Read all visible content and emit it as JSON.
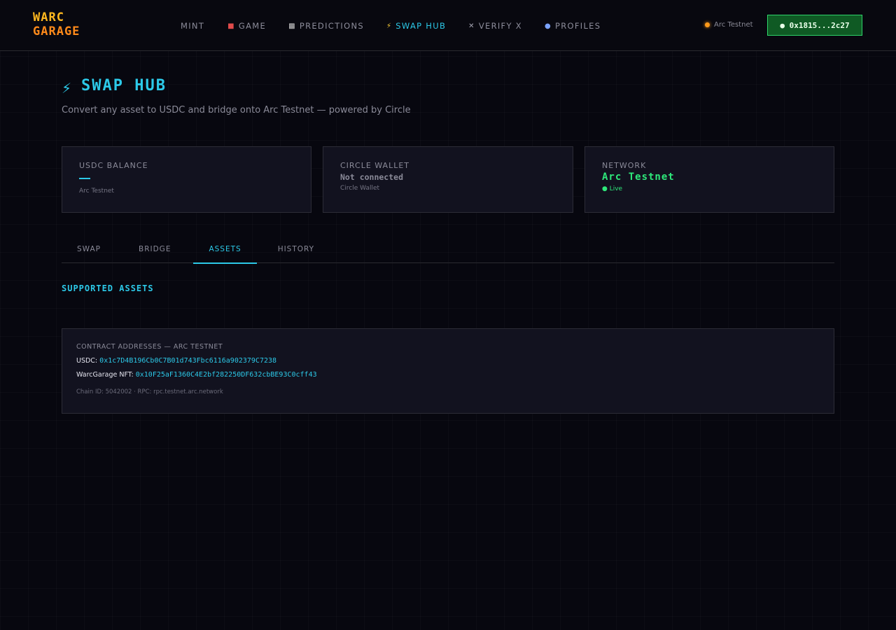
{
  "brand": {
    "line1": "WARC",
    "line2": "GARAGE"
  },
  "nav": [
    {
      "label": "MINT",
      "icon": ""
    },
    {
      "label": "GAME",
      "icon": "joystick-icon"
    },
    {
      "label": "PREDICTIONS",
      "icon": "checkered-flag-icon"
    },
    {
      "label": "SWAP HUB",
      "icon": "lightning-icon",
      "active": true
    },
    {
      "label": "VERIFY X",
      "icon": "x-icon"
    },
    {
      "label": "PROFILES",
      "icon": "person-icon"
    }
  ],
  "network_indicator": "Arc Testnet",
  "wallet_button": "● 0x1815...2c27",
  "page": {
    "title": "SWAP HUB",
    "subtitle": "Convert any asset to USDC and bridge onto Arc Testnet — powered by Circle"
  },
  "cards": {
    "balance": {
      "label": "USDC BALANCE",
      "sub": "Arc Testnet"
    },
    "wallet": {
      "label": "CIRCLE WALLET",
      "value": "Not connected",
      "sub": "Circle Wallet"
    },
    "network": {
      "label": "NETWORK",
      "value": "Arc Testnet",
      "status": "● Live"
    }
  },
  "tabs": [
    {
      "label": "SWAP"
    },
    {
      "label": "BRIDGE"
    },
    {
      "label": "ASSETS",
      "active": true
    },
    {
      "label": "HISTORY"
    }
  ],
  "section_title": "SUPPORTED ASSETS",
  "contracts": {
    "heading": "CONTRACT ADDRESSES — ARC TESTNET",
    "usdc_label": "USDC:",
    "usdc_address": "0x1c7D4B196Cb0C7B01d743Fbc6116a902379C7238",
    "nft_label": "WarcGarage NFT:",
    "nft_address": "0x10F25aF1360C4E2bf282250DF632cbBE93C0cff43",
    "meta": "Chain ID: 5042002 · RPC: rpc.testnet.arc.network"
  },
  "colors": {
    "accent": "#2cc9e8",
    "live_green": "#2ee87a",
    "logo_yellow": "#ffb81f",
    "logo_orange": "#ff8a1a",
    "wallet_bg": "#0f5a24"
  }
}
